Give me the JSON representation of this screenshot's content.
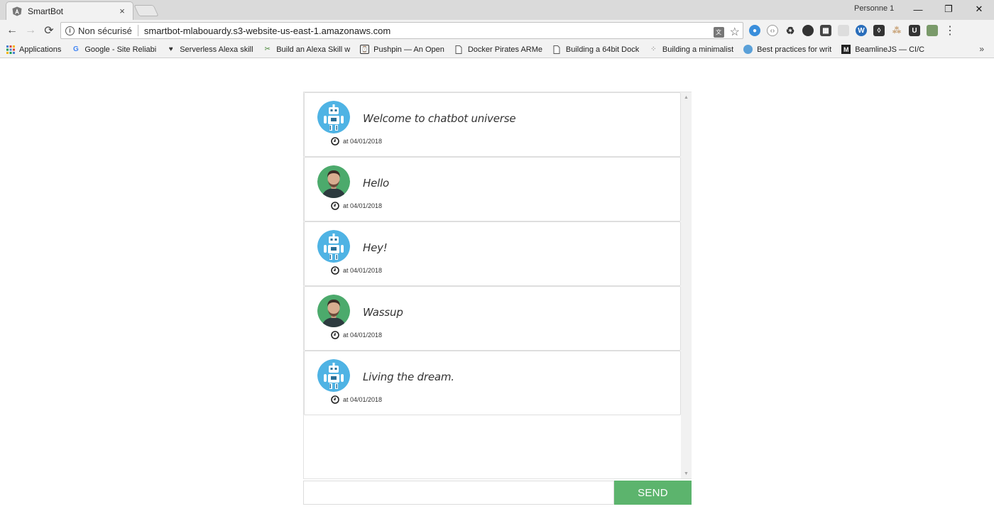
{
  "browser": {
    "tab_title": "SmartBot",
    "tab_close": "×",
    "profile_name": "Personne 1",
    "security_label": "Non sécurisé",
    "url": "smartbot-mlabouardy.s3-website-us-east-1.amazonaws.com",
    "bookmarks": [
      {
        "label": "Applications",
        "icon": "apps-grid-icon"
      },
      {
        "label": "Google - Site Reliabi",
        "icon": "google-icon"
      },
      {
        "label": "Serverless Alexa skill",
        "icon": "heart-icon"
      },
      {
        "label": "Build an Alexa Skill w",
        "icon": "tool-icon"
      },
      {
        "label": "Pushpin — An Open",
        "icon": "pushpin-icon"
      },
      {
        "label": "Docker Pirates ARMe",
        "icon": "page-icon"
      },
      {
        "label": "Building a 64bit Dock",
        "icon": "page-icon"
      },
      {
        "label": "Building a minimalist",
        "icon": "dotted-icon"
      },
      {
        "label": "Best practices for writ",
        "icon": "globe-icon"
      },
      {
        "label": "BeamlineJS — CI/CD",
        "icon": "medium-icon"
      }
    ],
    "bookmarks_more": "»"
  },
  "chat": {
    "messages": [
      {
        "sender": "bot",
        "text": "Welcome to chatbot universe",
        "time": "at 04/01/2018"
      },
      {
        "sender": "user",
        "text": "Hello",
        "time": "at 04/01/2018"
      },
      {
        "sender": "bot",
        "text": "Hey!",
        "time": "at 04/01/2018"
      },
      {
        "sender": "user",
        "text": "Wassup",
        "time": "at 04/01/2018"
      },
      {
        "sender": "bot",
        "text": "Living the dream.",
        "time": "at 04/01/2018"
      }
    ],
    "input_value": "",
    "send_label": "SEND"
  },
  "colors": {
    "send_button": "#5cb46d",
    "bot_avatar_bg": "#4fb3e4",
    "user_avatar_bg": "#4caa6c"
  }
}
